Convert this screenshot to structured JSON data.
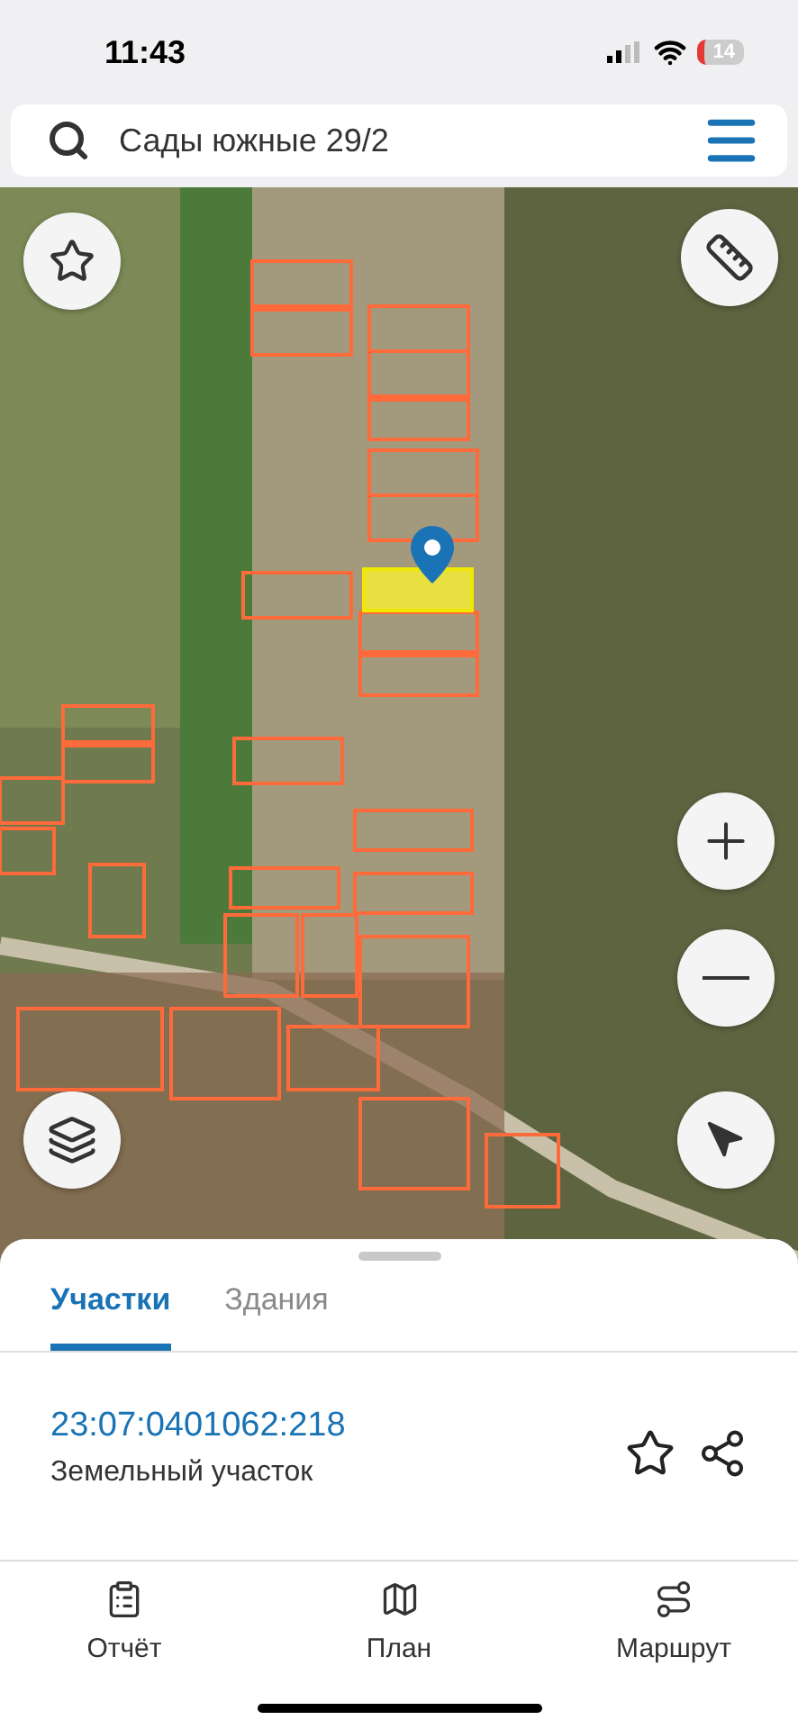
{
  "status_bar": {
    "time": "11:43",
    "battery": "14"
  },
  "search": {
    "value": "Сады южные 29/2"
  },
  "tabs": [
    {
      "label": "Участки",
      "selected": true
    },
    {
      "label": "Здания",
      "selected": false
    }
  ],
  "parcel": {
    "number": "23:07:0401062:218",
    "type": "Земельный участок"
  },
  "bottom_nav": [
    {
      "label": "Отчёт",
      "kind": "report"
    },
    {
      "label": "План",
      "kind": "plan"
    },
    {
      "label": "Маршрут",
      "kind": "route"
    }
  ]
}
